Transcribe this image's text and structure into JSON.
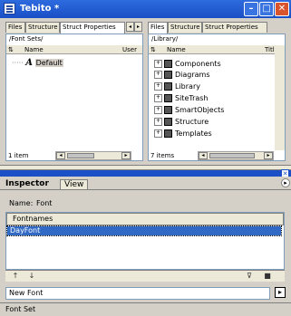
{
  "window": {
    "title": "Tebito *"
  },
  "left_pane": {
    "tabs": [
      "Files",
      "Structure",
      "Struct Properties"
    ],
    "path": "/Font Sets/",
    "columns": [
      "Name",
      "User"
    ],
    "items": [
      {
        "label": "Default",
        "icon": "font-a-icon"
      }
    ],
    "status": "1 item"
  },
  "right_pane": {
    "tabs": [
      "Files",
      "Structure",
      "Struct Properties"
    ],
    "path": "/Library/",
    "columns": [
      "Name",
      "Title"
    ],
    "items": [
      {
        "label": "Components",
        "icon": "folder-icon"
      },
      {
        "label": "Diagrams",
        "icon": "folder-icon"
      },
      {
        "label": "Library",
        "icon": "folder-icon"
      },
      {
        "label": "SiteTrash",
        "icon": "folder-icon"
      },
      {
        "label": "SmartObjects",
        "icon": "folder-icon"
      },
      {
        "label": "Structure",
        "icon": "folder-icon"
      },
      {
        "label": "Templates",
        "icon": "folder-icon"
      }
    ],
    "status": "7 items"
  },
  "inspector": {
    "tabs": [
      "Inspector",
      "View"
    ],
    "name_label": "Name:",
    "name_value": "Font",
    "list_header": "Fontnames",
    "list_items": [
      "DayFont"
    ],
    "selected_index": 0,
    "input_value": "New Font",
    "status": "Font Set"
  }
}
